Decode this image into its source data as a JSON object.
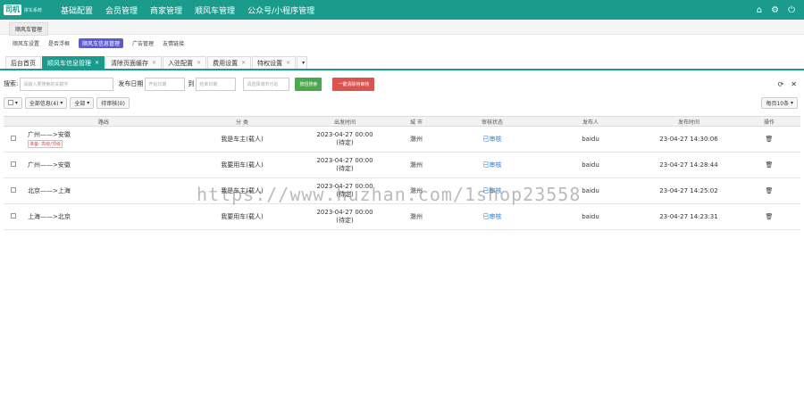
{
  "brand": {
    "badge": "司机",
    "name": "拼车系统"
  },
  "topnav": [
    "基础配置",
    "会员管理",
    "商家管理",
    "顺风车管理",
    "公众号/小程序管理"
  ],
  "topicons": {
    "home": "⌂",
    "settings": "⚙",
    "power": "⏻"
  },
  "section_title": "顺风车管理",
  "subnav": [
    "顺风车设置",
    "是否浮框",
    "顺风车信息管理",
    "广告管理",
    "友情链接"
  ],
  "tabs": [
    "后台首页",
    "顺风车信息管理",
    "清除页面缓存",
    "入驻配置",
    "费用设置",
    "特权设置"
  ],
  "filters": {
    "search_label": "搜索:",
    "search_placeholder": "请输入要搜索的关键字",
    "date_label": "发布日期",
    "start_placeholder": "开始日期",
    "to": "到",
    "end_placeholder": "结束日期",
    "city_placeholder": "请选择城市分站",
    "search_btn": "按钮搜索",
    "clear_btn": "一键清除待审核"
  },
  "toolbar": {
    "all_status": "全部信息(4)",
    "all": "全部",
    "pending": "待审核(0)",
    "per_page": "每页10条"
  },
  "columns": [
    "路线",
    "分 类",
    "出发时间",
    "城 市",
    "审核状态",
    "发布人",
    "发布时间",
    "操作"
  ],
  "rows": [
    {
      "route": "广州——>安徽",
      "tag": "准备: 高级/顶级",
      "category": "我是车主(载人)",
      "time": "2023-04-27 00:00",
      "time2": "(待定)",
      "city": "滁州",
      "audit": "已审核",
      "publisher": "baidu",
      "pubtime": "23-04-27 14:30:06"
    },
    {
      "route": "广州——>安徽",
      "tag": "",
      "category": "我要用车(载人)",
      "time": "2023-04-27 00:00",
      "time2": "(待定)",
      "city": "滁州",
      "audit": "已审核",
      "publisher": "baidu",
      "pubtime": "23-04-27 14:28:44"
    },
    {
      "route": "北京——>上海",
      "tag": "",
      "category": "我是车主(载人)",
      "time": "2023-04-27 00:00",
      "time2": "(待定)",
      "city": "滁州",
      "audit": "已审核",
      "publisher": "baidu",
      "pubtime": "23-04-27 14:25:02"
    },
    {
      "route": "上海——>北京",
      "tag": "",
      "category": "我要用车(载人)",
      "time": "2023-04-27 00:00",
      "time2": "(待定)",
      "city": "滁州",
      "audit": "已审核",
      "publisher": "baidu",
      "pubtime": "23-04-27 14:23:31"
    }
  ],
  "watermark": "https://www.huzhan.com/1shop23558"
}
